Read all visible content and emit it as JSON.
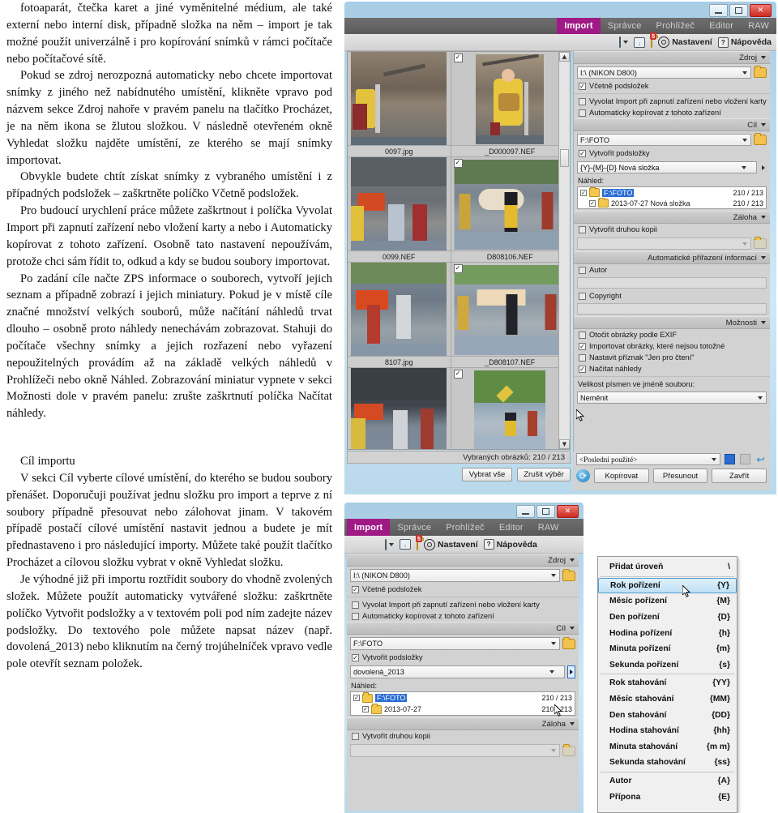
{
  "document": {
    "paragraphs": [
      "fotoaparát, čtečka karet a jiné vyměnitelné médium, ale také externí nebo interní disk, případně složka na něm – import je tak možné použít univerzálně i pro kopírování snímků v rámci počítače nebo počítačové sítě.",
      "Pokud se zdroj nerozpozná automaticky nebo chcete importovat snímky z jiného než nabídnutého umístění, klikněte vpravo pod názvem sekce Zdroj nahoře v pravém panelu na tlačítko Procházet, je na něm ikona se žlutou složkou. V následně otevřeném okně Vyhledat složku najděte umístění, ze kterého se mají snímky importovat.",
      "Obvykle budete chtít získat snímky z vybraného umístění i z případných podsložek – zaškrtněte políčko Včetně podsložek.",
      "Pro budoucí urychlení práce můžete zaškrtnout i políčka Vyvolat Import při zapnutí zařízení nebo vložení karty a nebo i Automaticky kopírovat z tohoto zařízení. Osobně tato nastavení nepoužívám, protože chci sám řídit to, odkud a kdy se budou soubory importovat.",
      "Po zadání cíle načte ZPS informace o souborech, vytvoří jejich seznam a případně zobrazí i jejich miniatury. Pokud je v místě cíle značné množství velkých souborů, může načítání náhledů trvat dlouho – osobně proto náhledy nenechávám zobrazovat. Stahuji do počítače všechny snímky a jejich rozřazení nebo vyřazení nepoužitelných provádím až na základě velkých náhledů v Prohlížeči nebo okně Náhled. Zobrazování miniatur vypnete v sekci Možnosti dole v pravém panelu: zrušte zaškrtnutí políčka Načítat náhledy."
    ],
    "heading": "Cíl importu",
    "paragraphs2": [
      "V sekci Cíl vyberte cílové umístění, do kterého se budou soubory přenášet. Doporučuji používat jednu složku pro import a teprve z ní soubory případně přesouvat nebo zálohovat jinam. V takovém případě postačí cílové umístění nastavit jednou a budete je mít přednastaveno i pro následující importy. Můžete také použít tlačítko Procházet a cílovou složku vybrat v okně Vyhledat složku.",
      "Je výhodné již při importu roztřídit soubory do vhodně zvolených složek. Můžete použít automaticky vytvářené složku: zaškrtněte políčko Vytvořit podsložky a v textovém poli pod ním zadejte název podsložky. Do textového pole můžete napsat název (např. dovolená_2013) nebo kliknutím na černý trojúhelníček vpravo vedle pole otevřít seznam položek."
    ]
  },
  "window_top": {
    "tabs": [
      {
        "label": "Import",
        "active": true
      },
      {
        "label": "Správce",
        "active": false
      },
      {
        "label": "Prohlížeč",
        "active": false
      },
      {
        "label": "Editor",
        "active": false
      },
      {
        "label": "RAW",
        "active": false
      }
    ],
    "toolbar": {
      "monitor_icon": "monitor-icon",
      "caret_icon": "chevron-down-icon",
      "download_icon": "download-icon",
      "folder_badge_icon": "folder-notification-icon",
      "badge_count": "5",
      "settings_label": "Nastavení",
      "help_label": "Nápověda",
      "help_glyph": "?"
    },
    "window_buttons": {
      "minimize": "–",
      "maximize": "□",
      "close": "✕"
    },
    "thumbnails": [
      {
        "label": "0097.jpg",
        "checked": true,
        "scene": "musician"
      },
      {
        "label": "_D000097.NEF",
        "checked": true,
        "scene": "musician"
      },
      {
        "label": "0099.NEF",
        "checked": true,
        "scene": "street"
      },
      {
        "label": "D808106.NEF",
        "checked": true,
        "scene": "street"
      },
      {
        "label": "8107.jpg",
        "checked": true,
        "scene": "street2"
      },
      {
        "label": "_D808107.NEF",
        "checked": true,
        "scene": "street2"
      },
      {
        "label": "",
        "checked": true,
        "scene": "park"
      },
      {
        "label": "",
        "checked": true,
        "scene": "park"
      }
    ],
    "selection_info": "Vybraných obrázků: 210 / 213",
    "buttons": {
      "select_all": "Vybrat vše",
      "clear_selection": "Zrušit výběr"
    },
    "panel": {
      "source_section": "Zdroj",
      "source_value": "I:\\ (NIKON D800)",
      "include_subfolders": {
        "label": "Včetně podsložek",
        "checked": true
      },
      "invoke_import": {
        "label": "Vyvolat Import při zapnutí zařízení nebo vložení karty",
        "checked": false
      },
      "auto_copy": {
        "label": "Automaticky kopírovat z tohoto zařízení",
        "checked": false
      },
      "target_section": "Cíl",
      "target_value": "F:\\FOTO",
      "create_subfolders": {
        "label": "Vytvořit podsložky",
        "checked": true
      },
      "subfolder_pattern": "{Y}-{M}-{D} Nová složka",
      "preview_label": "Náhled:",
      "tree": [
        {
          "name": "F:\\FOTO",
          "count": "210 / 213",
          "checked": true,
          "selected": true,
          "depth": 0
        },
        {
          "name": "2013-07-27 Nová složka",
          "count": "210 / 213",
          "checked": true,
          "selected": false,
          "depth": 1
        }
      ],
      "backup_section": "Záloha",
      "second_copy": {
        "label": "Vytvořit druhou kopii",
        "checked": false
      },
      "backup_path": "",
      "auto_info_section": "Automatické přiřazení informací",
      "author": {
        "label": "Autor",
        "checked": false,
        "value": ""
      },
      "copyright": {
        "label": "Copyright",
        "checked": false,
        "value": ""
      },
      "options_section": "Možnosti",
      "rotate_exif": {
        "label": "Otočit obrázky podle EXIF",
        "checked": false
      },
      "import_not_identical": {
        "label": "Importovat obrázky, které nejsou totožné",
        "checked": true
      },
      "readonly_flag": {
        "label": "Nastavit příznak \"Jen pro čtení\"",
        "checked": false
      },
      "load_thumbnails": {
        "label": "Načítat náhledy",
        "checked": true
      },
      "case_label": "Velikost písmen ve jméně souboru:",
      "case_value": "Neměnit",
      "history_value": "<Poslední použité>",
      "actions": {
        "copy": "Kopírovat",
        "move": "Přesunout",
        "close": "Zavřít"
      }
    }
  },
  "window_bottom": {
    "tabs": [
      {
        "label": "Import",
        "active": true
      },
      {
        "label": "Správce",
        "active": false
      },
      {
        "label": "Prohlížeč",
        "active": false
      },
      {
        "label": "Editor",
        "active": false
      },
      {
        "label": "RAW",
        "active": false
      }
    ],
    "toolbar": {
      "badge_count": "5",
      "settings_label": "Nastavení",
      "help_label": "Nápověda",
      "help_glyph": "?"
    },
    "panel": {
      "source_section": "Zdroj",
      "source_value": "I:\\ (NIKON D800)",
      "include_subfolders": {
        "label": "Včetně podsložek",
        "checked": true
      },
      "invoke_import": {
        "label": "Vyvolat Import při zapnutí zařízení nebo vložení karty",
        "checked": false
      },
      "auto_copy": {
        "label": "Automaticky kopírovat z tohoto zařízení",
        "checked": false
      },
      "target_section": "Cíl",
      "target_value": "F:\\FOTO",
      "create_subfolders": {
        "label": "Vytvořit podsložky",
        "checked": true
      },
      "subfolder_pattern": "dovolená_2013",
      "preview_label": "Náhled:",
      "tree": [
        {
          "name": "F:\\FOTO",
          "count": "210 / 213",
          "checked": true,
          "selected": true,
          "depth": 0
        },
        {
          "name": "2013-07-27",
          "count": "210 / 213",
          "checked": true,
          "selected": false,
          "depth": 1
        }
      ],
      "backup_section": "Záloha",
      "second_copy": {
        "label": "Vytvořit druhou kopii",
        "checked": false
      }
    },
    "context_menu": [
      {
        "label": "Přidat úroveň",
        "key": "\\",
        "highlight": false,
        "separator_after": true
      },
      {
        "label": "Rok pořízení",
        "key": "{Y}",
        "highlight": true,
        "separator_after": false
      },
      {
        "label": "Měsíc pořízení",
        "key": "{M}",
        "highlight": false,
        "separator_after": false
      },
      {
        "label": "Den pořízení",
        "key": "{D}",
        "highlight": false,
        "separator_after": false
      },
      {
        "label": "Hodina pořízení",
        "key": "{h}",
        "highlight": false,
        "separator_after": false
      },
      {
        "label": "Minuta pořízení",
        "key": "{m}",
        "highlight": false,
        "separator_after": false
      },
      {
        "label": "Sekunda pořízení",
        "key": "{s}",
        "highlight": false,
        "separator_after": true
      },
      {
        "label": "Rok stahování",
        "key": "{YY}",
        "highlight": false,
        "separator_after": false
      },
      {
        "label": "Měsíc stahování",
        "key": "{MM}",
        "highlight": false,
        "separator_after": false
      },
      {
        "label": "Den stahování",
        "key": "{DD}",
        "highlight": false,
        "separator_after": false
      },
      {
        "label": "Hodina stahování",
        "key": "{hh}",
        "highlight": false,
        "separator_after": false
      },
      {
        "label": "Minuta stahování",
        "key": "{m m}",
        "highlight": false,
        "separator_after": false
      },
      {
        "label": "Sekunda stahování",
        "key": "{ss}",
        "highlight": false,
        "separator_after": true
      },
      {
        "label": "Autor",
        "key": "{A}",
        "highlight": false,
        "separator_after": false
      },
      {
        "label": "Přípona",
        "key": "{E}",
        "highlight": false,
        "separator_after": false
      }
    ]
  },
  "colors": {
    "accent": "#a01a86",
    "glass": "#bddcee",
    "panel": "#d2d2d2",
    "selection": "#2a6cd4",
    "badge": "#c9332b"
  }
}
